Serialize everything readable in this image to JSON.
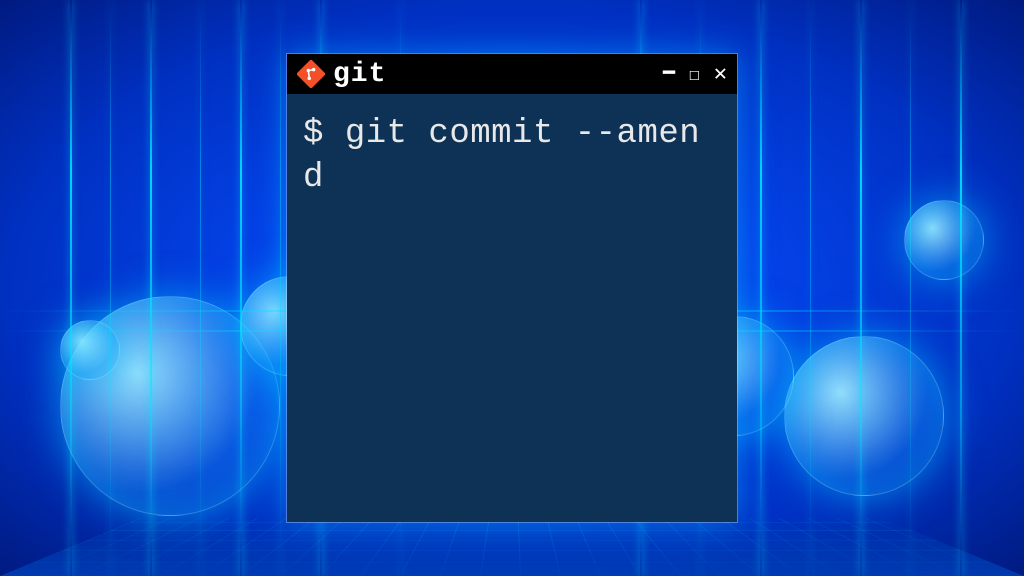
{
  "window": {
    "app_title": "git",
    "icon_name": "git-icon"
  },
  "terminal": {
    "prompt": "$ ",
    "command": "git commit --amend"
  },
  "colors": {
    "titlebar_bg": "#000000",
    "terminal_bg": "#0d3255",
    "terminal_fg": "#e8e8e8",
    "git_icon": "#f34f29",
    "bg_accent": "#00c8ff"
  }
}
